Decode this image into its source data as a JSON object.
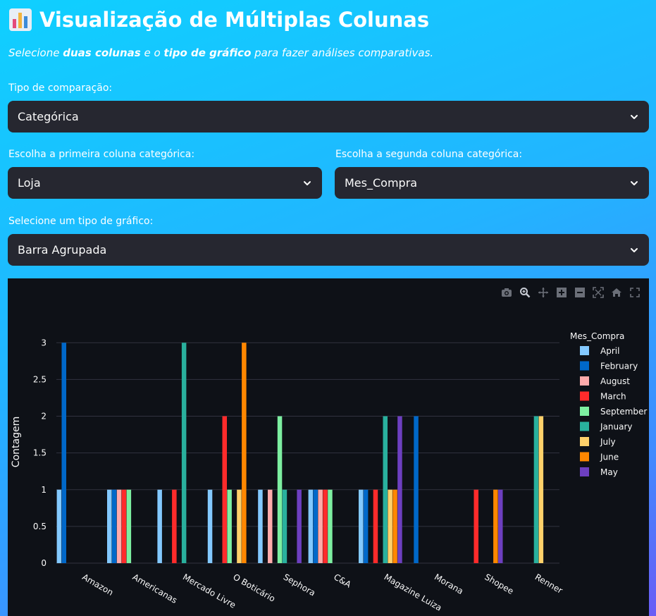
{
  "header": {
    "title": "Visualização de Múltiplas Colunas",
    "subtitle_parts": [
      "Selecione ",
      "duas colunas",
      " e o ",
      "tipo de gráfico",
      " para fazer análises comparativas."
    ]
  },
  "controls": {
    "comparison_label": "Tipo de comparação:",
    "comparison_value": "Categórica",
    "first_col_label": "Escolha a primeira coluna categórica:",
    "first_col_value": "Loja",
    "second_col_label": "Escolha a segunda coluna categórica:",
    "second_col_value": "Mes_Compra",
    "chart_type_label": "Selecione um tipo de gráfico:",
    "chart_type_value": "Barra Agrupada"
  },
  "colors": {
    "select_bg": "#262730",
    "chart_bg": "#0e1117"
  },
  "chart_data": {
    "type": "bar",
    "ylabel": "Contagem",
    "xlabel": "",
    "ylim": [
      0,
      3.3
    ],
    "yticks": [
      0,
      0.5,
      1,
      1.5,
      2,
      2.5,
      3
    ],
    "legend_title": "Mes_Compra",
    "legend_position": "right",
    "categories": [
      "Amazon",
      "Americanas",
      "Mercado Livre",
      "O Boticário",
      "Sephora",
      "C&A",
      "Magazine Luiza",
      "Morana",
      "Shopee",
      "Renner"
    ],
    "series": [
      {
        "name": "April",
        "color": "#83c9ff",
        "values": [
          1,
          1,
          1,
          1,
          1,
          1,
          1,
          0,
          0,
          0
        ]
      },
      {
        "name": "February",
        "color": "#0068c9",
        "values": [
          3,
          1,
          0,
          0,
          0,
          1,
          1,
          2,
          0,
          0
        ]
      },
      {
        "name": "August",
        "color": "#ffabab",
        "values": [
          0,
          1,
          0,
          0,
          1,
          1,
          0,
          0,
          0,
          0
        ]
      },
      {
        "name": "March",
        "color": "#ff2b2b",
        "values": [
          0,
          1,
          1,
          2,
          0,
          1,
          1,
          0,
          1,
          0
        ]
      },
      {
        "name": "September",
        "color": "#7defa1",
        "values": [
          0,
          1,
          0,
          1,
          2,
          1,
          0,
          0,
          0,
          0
        ]
      },
      {
        "name": "January",
        "color": "#29b09d",
        "values": [
          0,
          0,
          3,
          0,
          1,
          0,
          2,
          0,
          0,
          2
        ]
      },
      {
        "name": "July",
        "color": "#ffd16a",
        "values": [
          0,
          0,
          0,
          1,
          0,
          0,
          1,
          0,
          0,
          2
        ]
      },
      {
        "name": "June",
        "color": "#ff8700",
        "values": [
          0,
          0,
          0,
          3,
          0,
          0,
          1,
          0,
          1,
          0
        ]
      },
      {
        "name": "May",
        "color": "#6d3fc0",
        "values": [
          0,
          0,
          0,
          0,
          1,
          0,
          2,
          0,
          1,
          0
        ]
      }
    ]
  }
}
